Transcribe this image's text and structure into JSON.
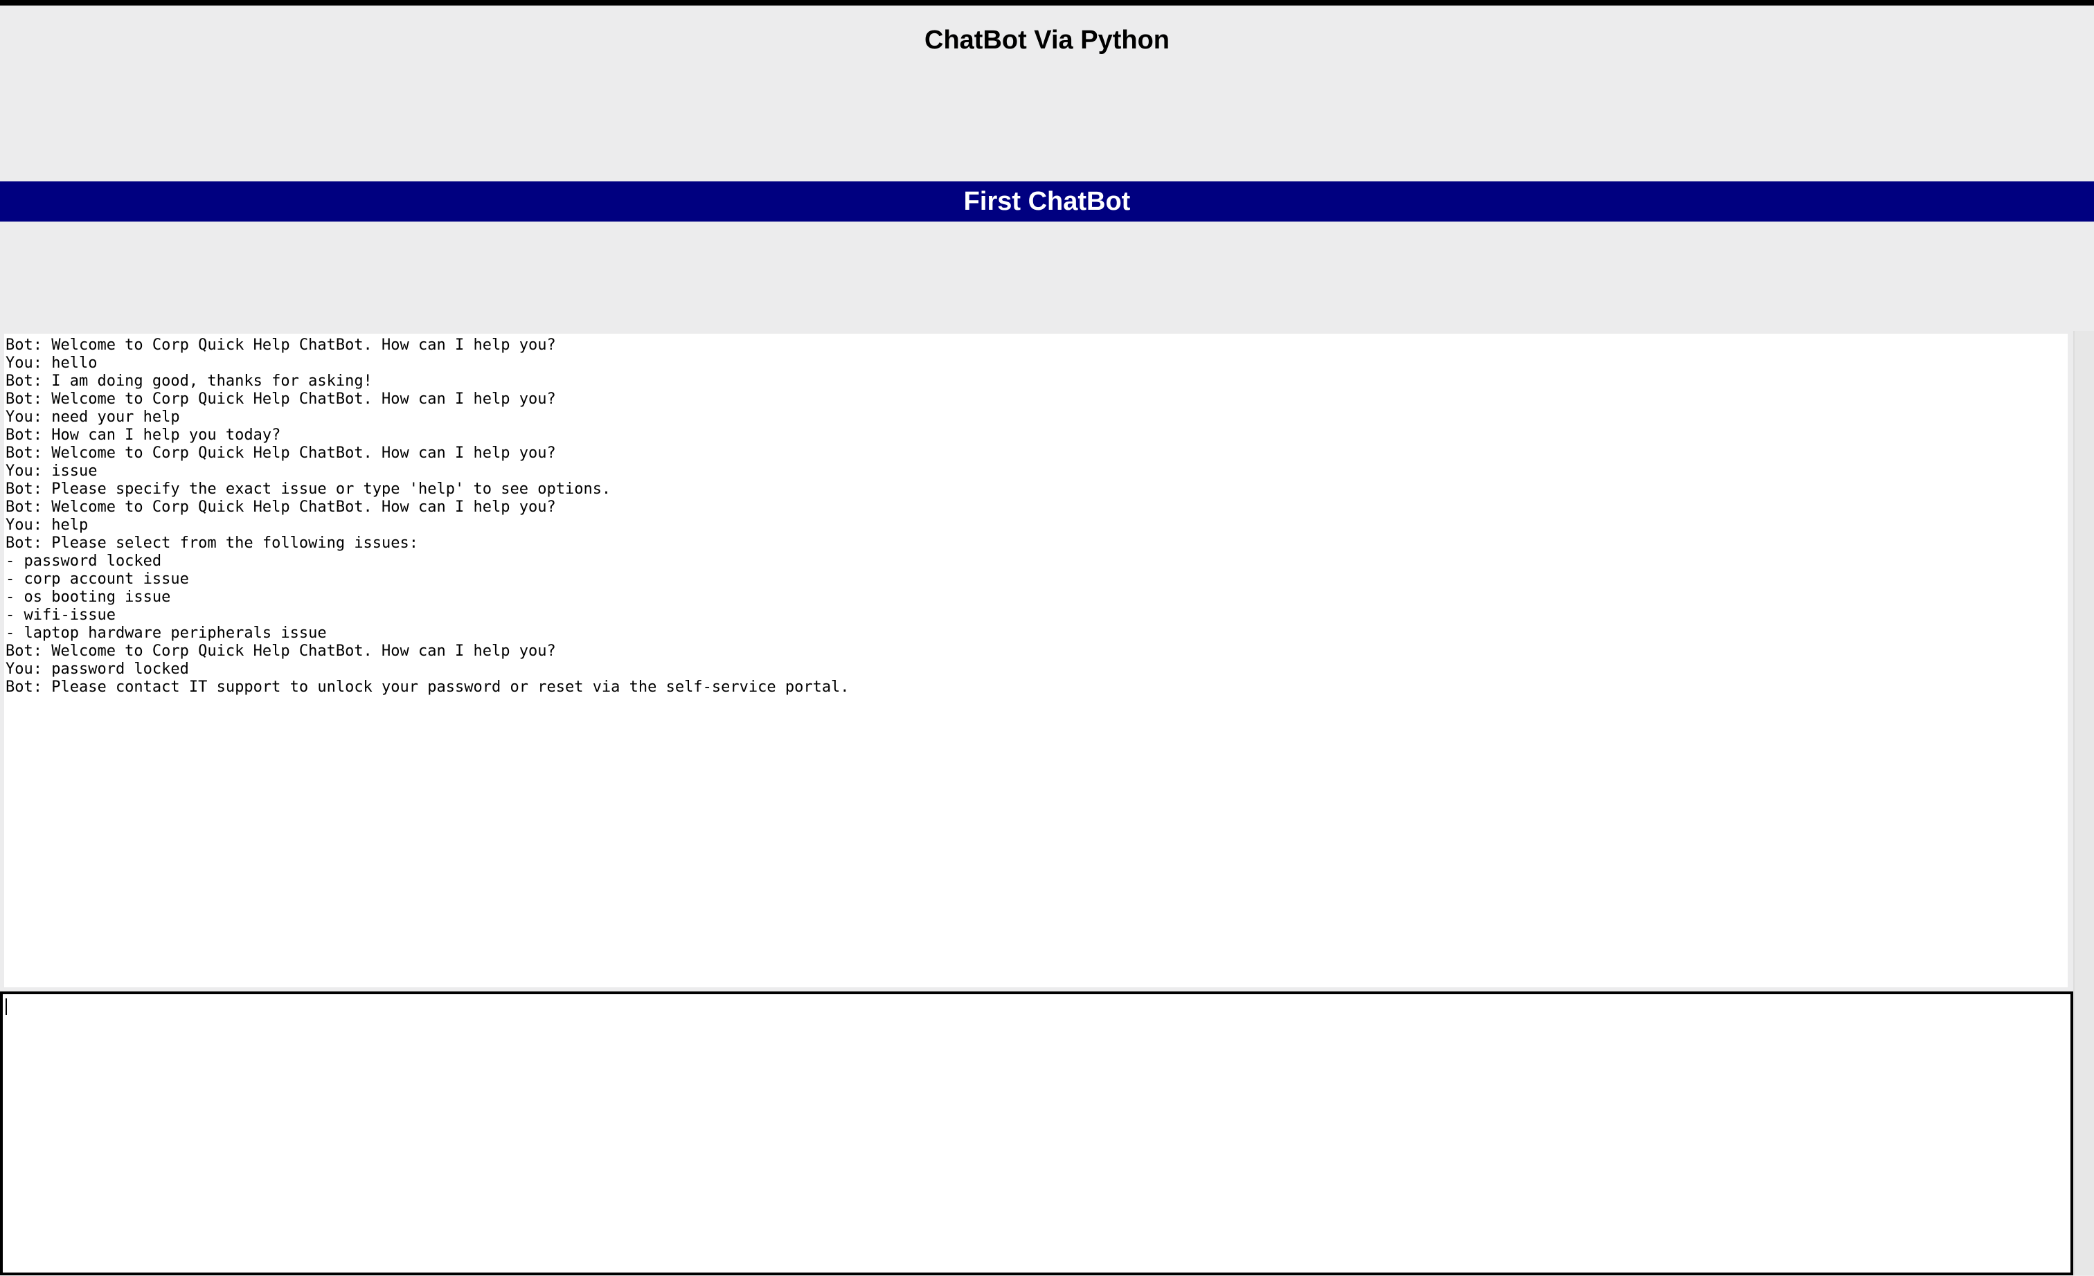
{
  "window": {
    "title": "ChatBot Via Python"
  },
  "banner": {
    "title": "First ChatBot",
    "color": "#000080"
  },
  "chat": {
    "lines": [
      "Bot: Welcome to Corp Quick Help ChatBot. How can I help you?",
      "You: hello",
      "Bot: I am doing good, thanks for asking!",
      "Bot: Welcome to Corp Quick Help ChatBot. How can I help you?",
      "You: need your help",
      "Bot: How can I help you today?",
      "Bot: Welcome to Corp Quick Help ChatBot. How can I help you?",
      "You: issue",
      "Bot: Please specify the exact issue or type 'help' to see options.",
      "Bot: Welcome to Corp Quick Help ChatBot. How can I help you?",
      "You: help",
      "Bot: Please select from the following issues:",
      "- password locked",
      "- corp account issue",
      "- os booting issue",
      "- wifi-issue",
      "- laptop hardware peripherals issue",
      "Bot: Welcome to Corp Quick Help ChatBot. How can I help you?",
      "You: password locked",
      "Bot: Please contact IT support to unlock your password or reset via the self-service portal."
    ]
  },
  "input": {
    "value": ""
  }
}
